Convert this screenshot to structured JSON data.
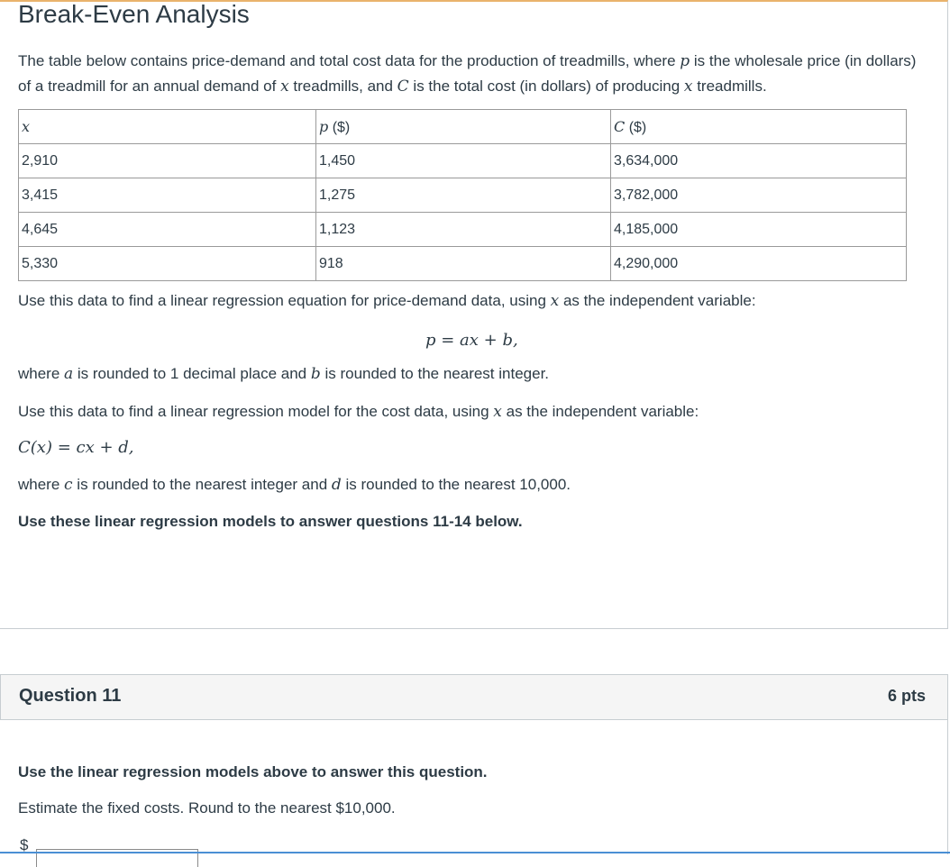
{
  "title": "Break-Even Analysis",
  "intro": {
    "part1": "The table below contains price-demand and total cost data for the production of treadmills, where ",
    "var_p": "p",
    "part2": " is the wholesale price (in dollars) of a treadmill for an annual demand of ",
    "var_x": "x",
    "part3": " treadmills, and ",
    "var_C": "C",
    "part4": " is the total cost (in dollars) of producing ",
    "part5": " treadmills."
  },
  "table": {
    "headers": [
      {
        "var": "x",
        "unit": ""
      },
      {
        "var": "p",
        "unit": " ($)"
      },
      {
        "var": "C",
        "unit": " ($)"
      }
    ],
    "rows": [
      [
        "2,910",
        "1,450",
        "3,634,000"
      ],
      [
        "3,415",
        "1,275",
        "3,782,000"
      ],
      [
        "4,645",
        "1,123",
        "4,185,000"
      ],
      [
        "5,330",
        "918",
        "4,290,000"
      ]
    ]
  },
  "text": {
    "p1_a": "Use this data to find a linear regression equation for price-demand data, using ",
    "p1_b": " as the independent variable:",
    "eq1": "p = ax + b,",
    "p2_a": "where ",
    "var_a": "a",
    "p2_b": " is rounded to 1 decimal place and ",
    "var_b": "b",
    "p2_c": " is rounded to the nearest integer.",
    "p3_a": "Use this data to find a linear regression model for the cost data, using ",
    "p3_b": " as the independent variable:",
    "eq2": "C(x) = cx + d,",
    "p4_a": "where ",
    "var_c": "c",
    "p4_b": " is rounded to the nearest integer and ",
    "var_d": "d",
    "p4_c": " is rounded to the nearest 10,000.",
    "p5": "Use these linear regression models to answer questions 11-14 below."
  },
  "question": {
    "title": "Question 11",
    "points": "6 pts",
    "instruction": "Use the linear regression models above to answer this question.",
    "prompt": "Estimate the fixed costs.  Round to the nearest $10,000.",
    "currency": "$",
    "answer_value": ""
  },
  "colors": {
    "title_accent": "#e9b36c",
    "header_bg": "#f5f5f5",
    "border": "#c7cdd1",
    "focus_line": "#4a8fd4"
  }
}
